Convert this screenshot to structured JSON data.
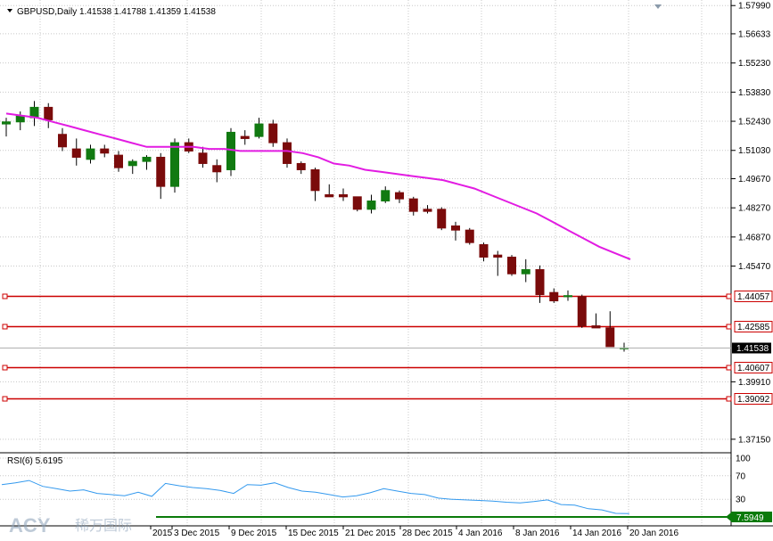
{
  "header": {
    "symbol_label": "GBPUSD,Daily",
    "ohlc": "1.41538 1.41788 1.41359 1.41538",
    "menu_icon": "triangle-down-icon"
  },
  "price_axis": {
    "ticks": [
      "1.57990",
      "1.56633",
      "1.55230",
      "1.53830",
      "1.52430",
      "1.51030",
      "1.49670",
      "1.48270",
      "1.46870",
      "1.45470",
      "1.44057",
      "1.42585",
      "1.41538",
      "1.40607",
      "1.39910",
      "1.39092",
      "1.37150"
    ],
    "min": 1.365,
    "max": 1.58
  },
  "levels": [
    {
      "value": 1.44057,
      "label": "1.44057",
      "color": "#cc0000"
    },
    {
      "value": 1.42585,
      "label": "1.42585",
      "color": "#cc0000"
    },
    {
      "value": 1.40607,
      "label": "1.40607",
      "color": "#cc0000"
    },
    {
      "value": 1.39092,
      "label": "1.39092",
      "color": "#cc0000"
    }
  ],
  "current_price": {
    "value": 1.41538,
    "label": "1.41538"
  },
  "time_axis": [
    "2015",
    "3 Dec 2015",
    "9 Dec 2015",
    "15 Dec 2015",
    "21 Dec 2015",
    "28 Dec 2015",
    "4 Jan 2016",
    "8 Jan 2016",
    "14 Jan 2016",
    "20 Jan 2016"
  ],
  "candles": [
    [
      1.523,
      1.526,
      1.517,
      1.524
    ],
    [
      1.524,
      1.529,
      1.52,
      1.527
    ],
    [
      1.526,
      1.534,
      1.522,
      1.531
    ],
    [
      1.531,
      1.533,
      1.521,
      1.525
    ],
    [
      1.518,
      1.521,
      1.51,
      1.512
    ],
    [
      1.511,
      1.516,
      1.503,
      1.507
    ],
    [
      1.506,
      1.513,
      1.504,
      1.511
    ],
    [
      1.511,
      1.513,
      1.507,
      1.509
    ],
    [
      1.508,
      1.51,
      1.5,
      1.502
    ],
    [
      1.503,
      1.506,
      1.499,
      1.505
    ],
    [
      1.505,
      1.508,
      1.501,
      1.507
    ],
    [
      1.507,
      1.509,
      1.487,
      1.493
    ],
    [
      1.493,
      1.516,
      1.49,
      1.514
    ],
    [
      1.514,
      1.516,
      1.509,
      1.51
    ],
    [
      1.509,
      1.512,
      1.502,
      1.504
    ],
    [
      1.503,
      1.506,
      1.495,
      1.5
    ],
    [
      1.501,
      1.521,
      1.498,
      1.519
    ],
    [
      1.517,
      1.52,
      1.513,
      1.516
    ],
    [
      1.517,
      1.526,
      1.516,
      1.523
    ],
    [
      1.523,
      1.525,
      1.512,
      1.514
    ],
    [
      1.514,
      1.516,
      1.502,
      1.504
    ],
    [
      1.504,
      1.505,
      1.499,
      1.501
    ],
    [
      1.501,
      1.502,
      1.486,
      1.491
    ],
    [
      1.489,
      1.494,
      1.488,
      1.488
    ],
    [
      1.489,
      1.492,
      1.486,
      1.488
    ],
    [
      1.488,
      1.488,
      1.481,
      1.482
    ],
    [
      1.482,
      1.489,
      1.48,
      1.486
    ],
    [
      1.486,
      1.493,
      1.485,
      1.491
    ],
    [
      1.49,
      1.491,
      1.485,
      1.487
    ],
    [
      1.487,
      1.488,
      1.479,
      1.481
    ],
    [
      1.482,
      1.484,
      1.48,
      1.481
    ],
    [
      1.482,
      1.483,
      1.472,
      1.473
    ],
    [
      1.474,
      1.476,
      1.467,
      1.472
    ],
    [
      1.472,
      1.473,
      1.465,
      1.466
    ],
    [
      1.465,
      1.466,
      1.457,
      1.459
    ],
    [
      1.46,
      1.462,
      1.45,
      1.459
    ],
    [
      1.459,
      1.46,
      1.45,
      1.451
    ],
    [
      1.451,
      1.458,
      1.447,
      1.453
    ],
    [
      1.453,
      1.455,
      1.437,
      1.441
    ],
    [
      1.442,
      1.444,
      1.437,
      1.438
    ],
    [
      1.44,
      1.443,
      1.438,
      1.4405
    ],
    [
      1.44,
      1.441,
      1.425,
      1.426
    ],
    [
      1.426,
      1.432,
      1.425,
      1.425
    ],
    [
      1.425,
      1.433,
      1.416,
      1.416
    ],
    [
      1.4154,
      1.4179,
      1.4136,
      1.4154
    ]
  ],
  "ma": [
    1.528,
    1.527,
    1.526,
    1.524,
    1.522,
    1.52,
    1.518,
    1.516,
    1.514,
    1.512,
    1.512,
    1.512,
    1.512,
    1.511,
    1.511,
    1.51,
    1.51,
    1.51,
    1.51,
    1.509,
    1.507,
    1.504,
    1.503,
    1.501,
    1.5,
    1.499,
    1.498,
    1.497,
    1.496,
    1.494,
    1.492,
    1.489,
    1.486,
    1.483,
    1.48,
    1.476,
    1.472,
    1.468,
    1.464,
    1.461,
    1.458
  ],
  "rsi": {
    "label": "RSI(6) 5.6195",
    "ticks": [
      "100",
      "70",
      "30"
    ],
    "values": [
      55,
      58,
      62,
      52,
      48,
      44,
      46,
      40,
      38,
      36,
      42,
      35,
      57,
      53,
      50,
      48,
      45,
      40,
      55,
      54,
      58,
      50,
      44,
      42,
      38,
      34,
      36,
      41,
      48,
      44,
      40,
      38,
      32,
      30,
      29,
      28,
      27,
      25,
      24,
      26,
      29,
      21,
      20,
      14,
      12,
      6,
      5.6
    ],
    "last_label": "7.5949"
  },
  "watermark": {
    "latin": "ACY",
    "cjk": "稀万国际"
  },
  "colors": {
    "bull": "#117a11",
    "bear": "#7a0b0b",
    "ma": "#e21ce2",
    "rsi": "#3399ee",
    "level": "#cc0000",
    "grid": "#c8c8c8",
    "rsi_base": "#0a7a0a"
  }
}
